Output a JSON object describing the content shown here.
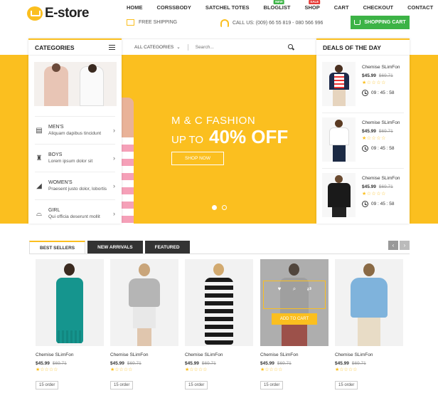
{
  "logo": {
    "text": "E-store"
  },
  "nav": [
    {
      "label": "HOME",
      "badge": null,
      "badge_color": null
    },
    {
      "label": "CORSSBODY",
      "badge": null,
      "badge_color": null
    },
    {
      "label": "SATCHEL TOTES",
      "badge": null,
      "badge_color": null
    },
    {
      "label": "BLOGLIST",
      "badge": "NEW",
      "badge_color": "#3cb346"
    },
    {
      "label": "SHOP",
      "badge": "SALE",
      "badge_color": "#e53935"
    },
    {
      "label": "CART",
      "badge": null,
      "badge_color": null
    },
    {
      "label": "CHECKOUT",
      "badge": null,
      "badge_color": null
    },
    {
      "label": "CONTACT",
      "badge": null,
      "badge_color": null
    }
  ],
  "topbar": {
    "shipping": "FREE SHIPPING",
    "call": "CALL US: (009) 66 55 819 - 080 566 996",
    "cart_button": "SHOPPING CART"
  },
  "categories": {
    "title": "CATEGORIES",
    "items": [
      {
        "name": "MEN'S",
        "desc": "Aliquam dapibus tincidunt",
        "icon": "shirt-icon",
        "glyph": "▤"
      },
      {
        "name": "BOYS",
        "desc": "Lorem ipsum dolor sit",
        "icon": "bag-icon",
        "glyph": "♜"
      },
      {
        "name": "WOMEN'S",
        "desc": "Praesent justo dolor, lobortis",
        "icon": "heel-icon",
        "glyph": "◢"
      },
      {
        "name": "GIRL",
        "desc": "Qui officia deserunt mollit",
        "icon": "hat-icon",
        "glyph": "⌓"
      }
    ]
  },
  "search": {
    "category": "ALL CATEGORIES",
    "placeholder": "Search..."
  },
  "banner": {
    "line1": "M & C FASHION",
    "upto": "UP TO",
    "off": "40% OFF",
    "button": "SHOP NOW"
  },
  "deals": {
    "title": "DEALS OF THE DAY",
    "items": [
      {
        "name": "Chemise SLimFon",
        "price": "$45.99",
        "old_price": "$69.71",
        "stars": "★☆☆☆☆",
        "timer": "09 : 45 : 58"
      },
      {
        "name": "Chemise SLimFon",
        "price": "$45.99",
        "old_price": "$69.71",
        "stars": "★☆☆☆☆",
        "timer": "09 : 45 : 58"
      },
      {
        "name": "Chemise SLimFon",
        "price": "$45.99",
        "old_price": "$69.71",
        "stars": "★☆☆☆☆",
        "timer": "09 : 45 : 58"
      }
    ]
  },
  "tabs": [
    "BEST SELLERS",
    "NEW ARRIVALS",
    "FEATURED"
  ],
  "products": [
    {
      "name": "Chemise SLimFon",
      "price": "$45.99",
      "old_price": "$69.71",
      "stars": "★☆☆☆☆",
      "order": "15 order"
    },
    {
      "name": "Chemise SLimFon",
      "price": "$45.99",
      "old_price": "$69.71",
      "stars": "★☆☆☆☆",
      "order": "15 order"
    },
    {
      "name": "Chemise SLimFon",
      "price": "$45.99",
      "old_price": "$69.71",
      "stars": "★☆☆☆☆",
      "order": "15 order"
    },
    {
      "name": "Chemise SLimFon",
      "price": "$45.99",
      "old_price": "$69.71",
      "stars": "★☆☆☆☆",
      "order": "15 order"
    },
    {
      "name": "Chemise SLimFon",
      "price": "$45.99",
      "old_price": "$69.71",
      "stars": "★☆☆☆☆",
      "order": "15 order"
    }
  ],
  "hover": {
    "add_to_cart": "ADD TO CART"
  },
  "colors": {
    "accent": "#fbbf1f",
    "cart_green": "#3cb346",
    "dark_tab": "#333333"
  }
}
